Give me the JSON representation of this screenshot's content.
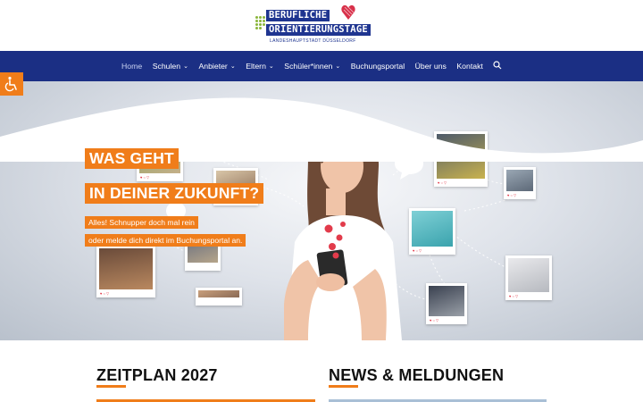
{
  "logo": {
    "line1": "BERUFLICHE",
    "line2": "ORIENTIERUNGSTAGE",
    "sub": "LANDESHAUPTSTADT DÜSSELDORF"
  },
  "nav": {
    "items": [
      {
        "label": "Home",
        "dropdown": false,
        "active": true
      },
      {
        "label": "Schulen",
        "dropdown": true
      },
      {
        "label": "Anbieter",
        "dropdown": true
      },
      {
        "label": "Eltern",
        "dropdown": true
      },
      {
        "label": "Schüler*innen",
        "dropdown": true
      },
      {
        "label": "Buchungsportal",
        "dropdown": false
      },
      {
        "label": "Über uns",
        "dropdown": false
      },
      {
        "label": "Kontakt",
        "dropdown": false
      }
    ],
    "search_icon": "search-icon"
  },
  "accessibility": {
    "icon": "wheelchair-icon"
  },
  "hero": {
    "headline1": "WAS GEHT",
    "headline2": "IN DEINER ZUKUNFT?",
    "tagline1": "Alles! Schnupper doch mal rein",
    "tagline2": "oder melde dich direkt im Buchungsportal an."
  },
  "sections": {
    "left_title": "ZEITPLAN 2027",
    "right_title": "NEWS & MELDUNGEN"
  },
  "colors": {
    "nav_bg": "#1b2f84",
    "accent": "#f07d1a",
    "logo_blue": "#1f3590",
    "logo_green": "#8ab53a",
    "divider_blue": "#a9bfd6"
  }
}
